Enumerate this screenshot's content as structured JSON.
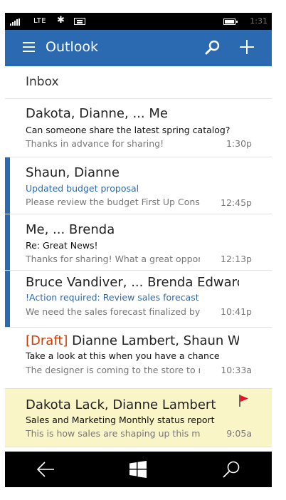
{
  "status_bar": {
    "network": "LTE",
    "bluetooth_icon": "bluetooth-icon",
    "message_icon": "message-icon",
    "battery_icon": "battery-icon",
    "time": "1:31"
  },
  "app_bar": {
    "title": "Outlook",
    "menu_icon": "hamburger-menu-icon",
    "search_icon": "search-icon",
    "compose_icon": "plus-icon"
  },
  "folder": {
    "label": "Inbox"
  },
  "messages": [
    {
      "draft_prefix": "",
      "sender": "Dakota, Dianne, ... Me",
      "subject": "Can someone share the latest spring catalog?",
      "preview": "Thanks in advance for sharing!",
      "time": "1:30p",
      "unread": false,
      "flagged": false,
      "selected": false
    },
    {
      "draft_prefix": "",
      "sender": "Shaun, Dianne",
      "subject": "Updated budget proposal",
      "preview": "Please review the budget First Up Consultant",
      "time": "12:45p",
      "unread": true,
      "flagged": false,
      "selected": false
    },
    {
      "draft_prefix": "",
      "sender": "Me, ... Brenda",
      "subject": "Re: Great News!",
      "preview": "Thanks for sharing! What a great opportunity",
      "time": "12:13p",
      "unread": true,
      "flagged": false,
      "selected": false
    },
    {
      "draft_prefix": "",
      "sender": "Bruce Vandiver, ... Brenda Edwards",
      "subject": "!Action required: Review sales forecast",
      "preview": "We need the sales forecast finalized by this",
      "time": "10:41p",
      "unread": true,
      "flagged": false,
      "selected": false
    },
    {
      "draft_prefix": "[Draft]",
      "sender": " Dianne Lambert, Shaun Wo",
      "subject": "Take a look at this when you have a chance",
      "preview": "The designer is coming to the store to review",
      "time": "10:33a",
      "unread": false,
      "flagged": false,
      "selected": false
    },
    {
      "draft_prefix": "",
      "sender": "Dakota Lack, Dianne Lambert",
      "subject": "Sales and Marketing Monthly status report",
      "preview": "This is how sales are shaping up this month.",
      "time": "9:05a",
      "unread": false,
      "flagged": true,
      "selected": true
    }
  ],
  "colors": {
    "accent": "#2b6ab1",
    "selected_row": "#f9f5c7",
    "flag": "#e81123",
    "draft": "#d83b01"
  },
  "nav_bar": {
    "back_icon": "back-arrow-icon",
    "start_icon": "windows-logo-icon",
    "search_icon": "search-icon"
  }
}
